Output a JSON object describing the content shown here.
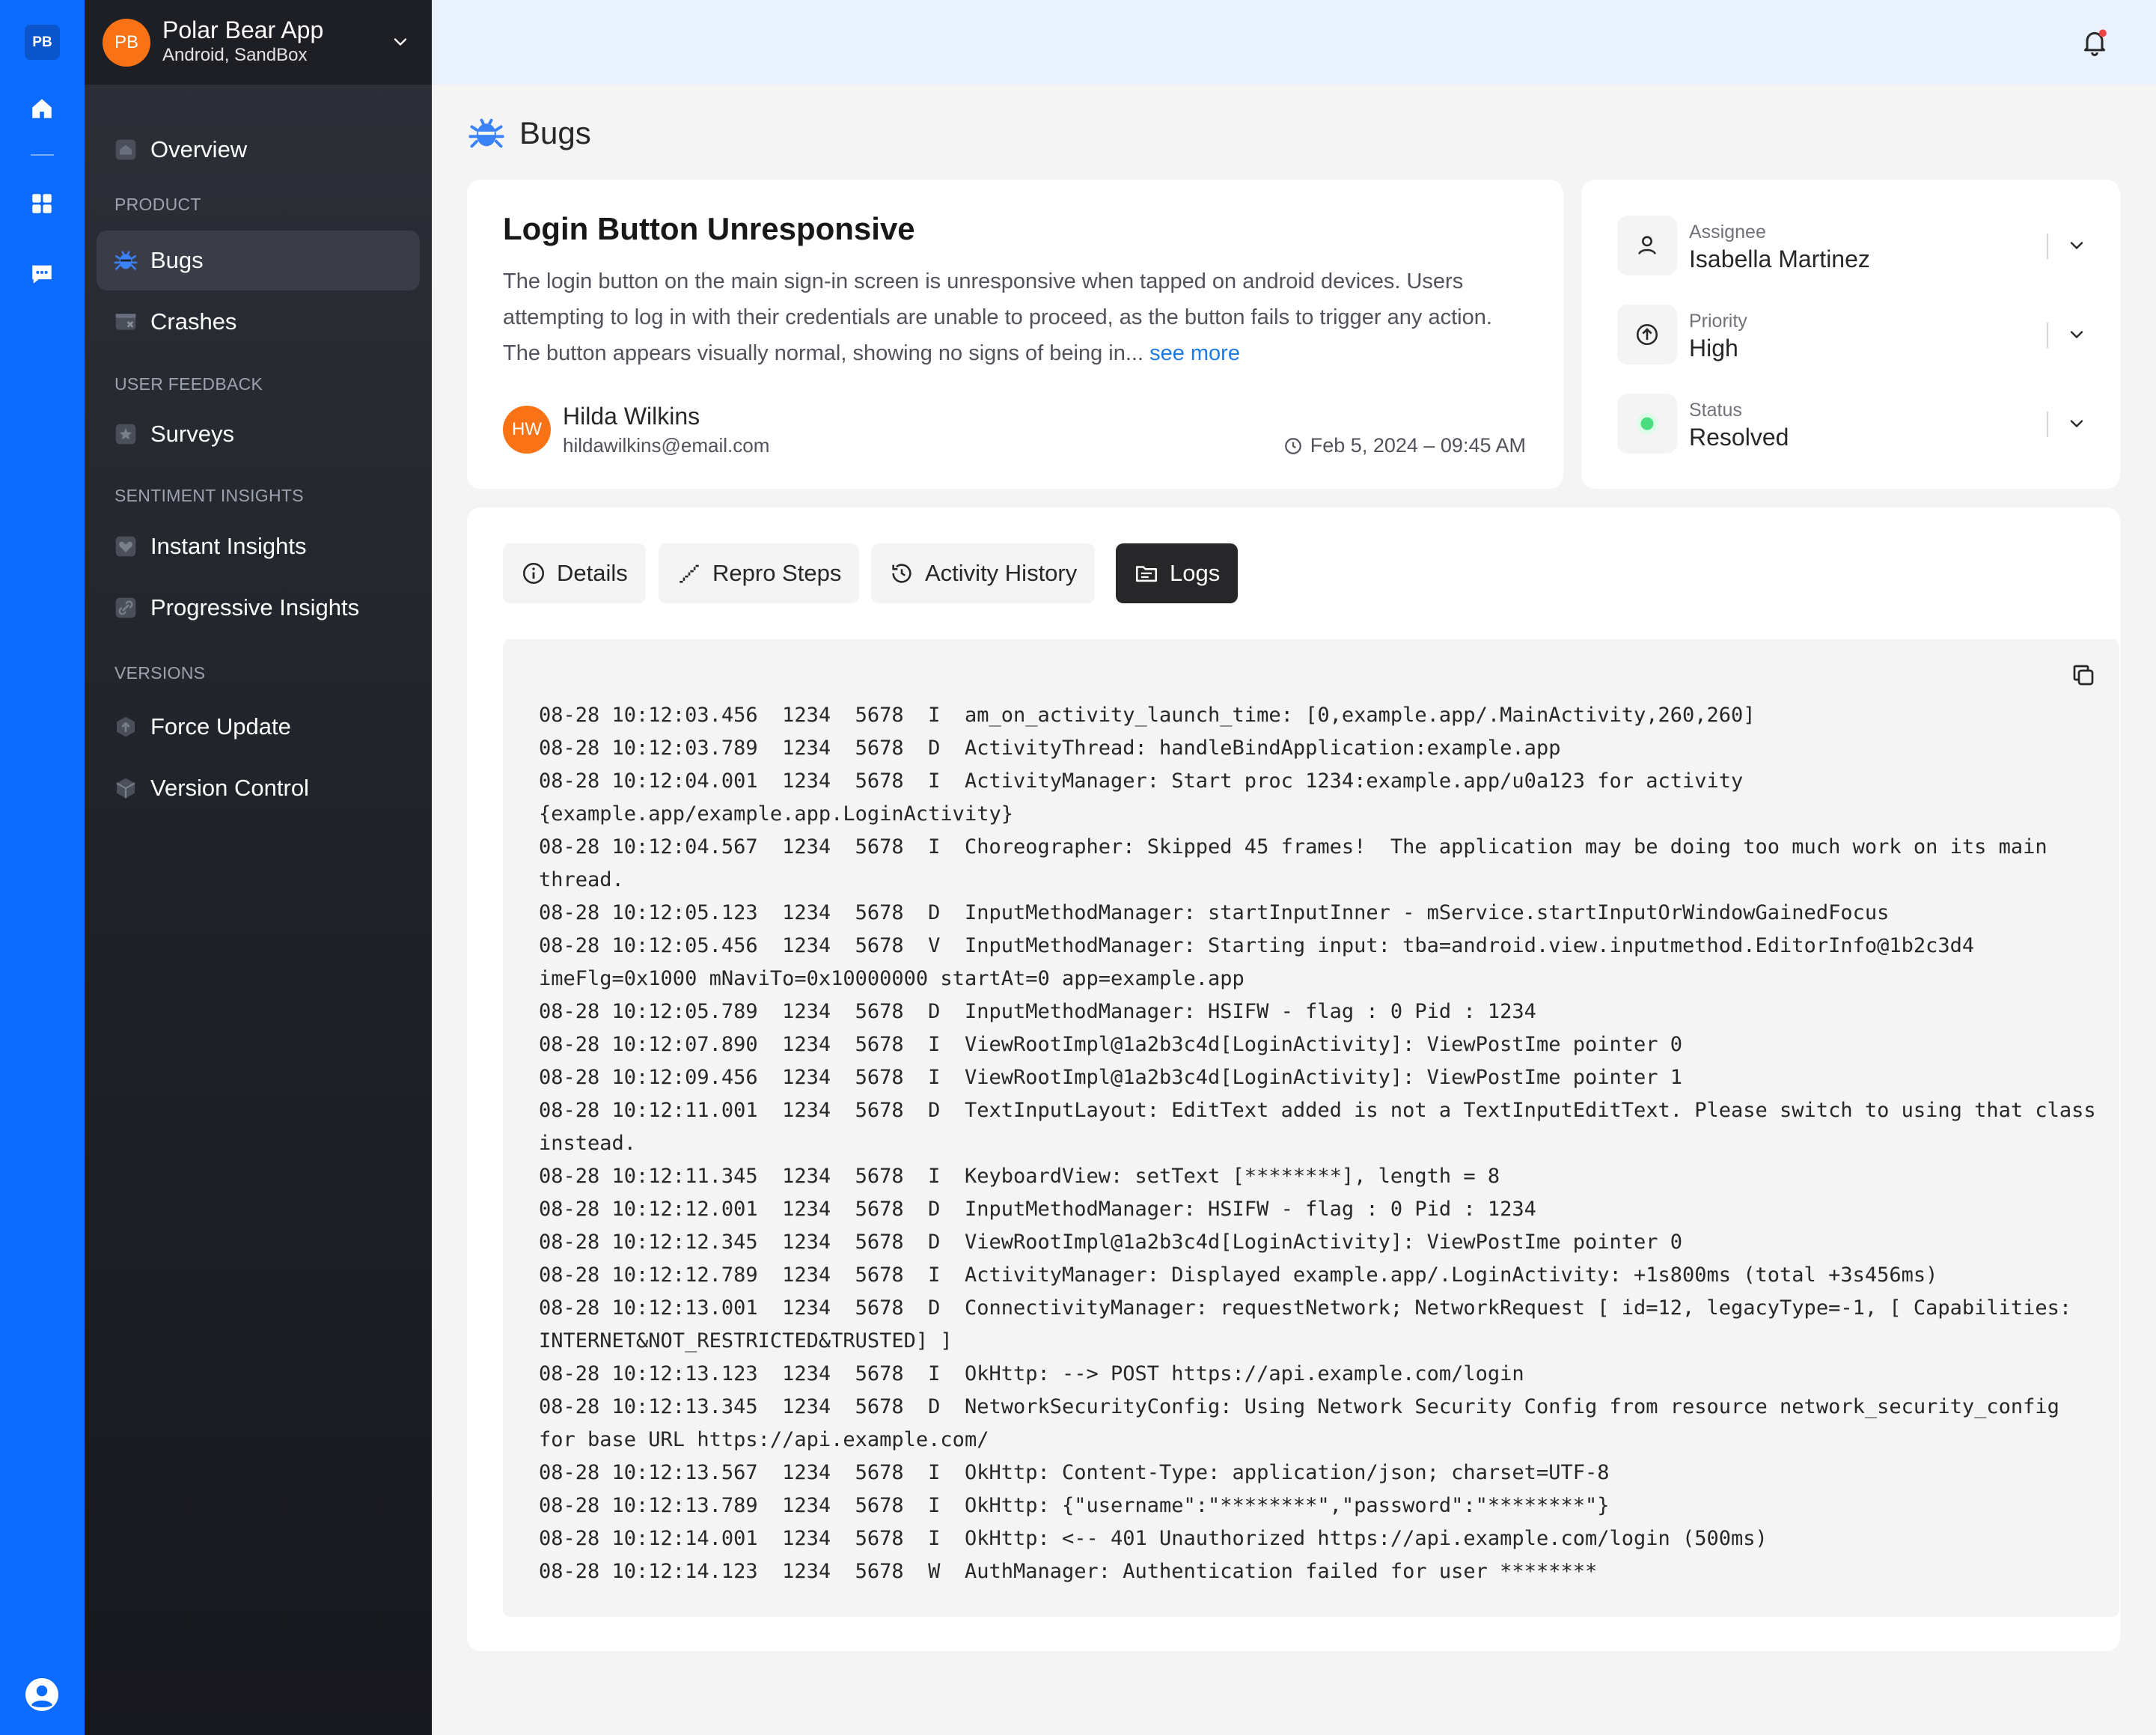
{
  "rail": {
    "logo": "PB",
    "icons": [
      "home-icon",
      "grid-icon",
      "chat-icon",
      "user-circle-icon"
    ]
  },
  "app": {
    "avatar": "PB",
    "name": "Polar Bear App",
    "platform": "Android, SandBox"
  },
  "sidebar": {
    "overview": "Overview",
    "sections": {
      "product": "PRODUCT",
      "user_feedback": "USER FEEDBACK",
      "sentiment": "SENTIMENT INSIGHTS",
      "versions": "VERSIONS"
    },
    "items": {
      "bugs": "Bugs",
      "crashes": "Crashes",
      "surveys": "Surveys",
      "instant_insights": "Instant Insights",
      "progressive_insights": "Progressive Insights",
      "force_update": "Force Update",
      "version_control": "Version Control"
    },
    "active": "Bugs"
  },
  "page": {
    "title": "Bugs"
  },
  "bug": {
    "title": "Login Button Unresponsive",
    "description": "The login button on the main sign-in screen is unresponsive when tapped on android devices. Users attempting to log in with their credentials are unable to proceed, as the button fails to trigger any action. The button appears visually normal, showing no signs of being in...",
    "see_more": "see more",
    "reporter": {
      "initials": "HW",
      "name": "Hilda Wilkins",
      "email": "hildawilkins@email.com"
    },
    "date": "Feb 5, 2024 – 09:45 AM"
  },
  "meta": {
    "assignee": {
      "label": "Assignee",
      "value": "Isabella Martinez"
    },
    "priority": {
      "label": "Priority",
      "value": "High"
    },
    "status": {
      "label": "Status",
      "value": "Resolved",
      "color": "#4ade80"
    }
  },
  "tabs": {
    "details": "Details",
    "repro_steps": "Repro Steps",
    "activity_history": "Activity History",
    "logs": "Logs",
    "active": "Logs"
  },
  "logs": [
    "08-28 10:12:03.456  1234  5678  I  am_on_activity_launch_time: [0,example.app/.MainActivity,260,260]",
    "08-28 10:12:03.789  1234  5678  D  ActivityThread: handleBindApplication:example.app",
    "08-28 10:12:04.001  1234  5678  I  ActivityManager: Start proc 1234:example.app/u0a123 for activity {example.app/example.app.LoginActivity}",
    "08-28 10:12:04.567  1234  5678  I  Choreographer: Skipped 45 frames!  The application may be doing too much work on its main thread.",
    "08-28 10:12:05.123  1234  5678  D  InputMethodManager: startInputInner - mService.startInputOrWindowGainedFocus",
    "08-28 10:12:05.456  1234  5678  V  InputMethodManager: Starting input: tba=android.view.inputmethod.EditorInfo@1b2c3d4 imeFlg=0x1000 mNaviTo=0x10000000 startAt=0 app=example.app",
    "08-28 10:12:05.789  1234  5678  D  InputMethodManager: HSIFW - flag : 0 Pid : 1234",
    "08-28 10:12:07.890  1234  5678  I  ViewRootImpl@1a2b3c4d[LoginActivity]: ViewPostIme pointer 0",
    "08-28 10:12:09.456  1234  5678  I  ViewRootImpl@1a2b3c4d[LoginActivity]: ViewPostIme pointer 1",
    "08-28 10:12:11.001  1234  5678  D  TextInputLayout: EditText added is not a TextInputEditText. Please switch to using that class instead.",
    "08-28 10:12:11.345  1234  5678  I  KeyboardView: setText [********], length = 8",
    "08-28 10:12:12.001  1234  5678  D  InputMethodManager: HSIFW - flag : 0 Pid : 1234",
    "08-28 10:12:12.345  1234  5678  D  ViewRootImpl@1a2b3c4d[LoginActivity]: ViewPostIme pointer 0",
    "08-28 10:12:12.789  1234  5678  I  ActivityManager: Displayed example.app/.LoginActivity: +1s800ms (total +3s456ms)",
    "08-28 10:12:13.001  1234  5678  D  ConnectivityManager: requestNetwork; NetworkRequest [ id=12, legacyType=-1, [ Capabilities: INTERNET&NOT_RESTRICTED&TRUSTED] ]",
    "08-28 10:12:13.123  1234  5678  I  OkHttp: --> POST https://api.example.com/login",
    "08-28 10:12:13.345  1234  5678  D  NetworkSecurityConfig: Using Network Security Config from resource network_security_config for base URL https://api.example.com/",
    "08-28 10:12:13.567  1234  5678  I  OkHttp: Content-Type: application/json; charset=UTF-8",
    "08-28 10:12:13.789  1234  5678  I  OkHttp: {\"username\":\"********\",\"password\":\"********\"}",
    "08-28 10:12:14.001  1234  5678  I  OkHttp: <-- 401 Unauthorized https://api.example.com/login (500ms)",
    "08-28 10:12:14.123  1234  5678  W  AuthManager: Authentication failed for user ********"
  ],
  "colors": {
    "rail": "#0d6bff",
    "accent_link": "#1e7be6",
    "avatar": "#f97316",
    "active_tab": "#27272a"
  }
}
